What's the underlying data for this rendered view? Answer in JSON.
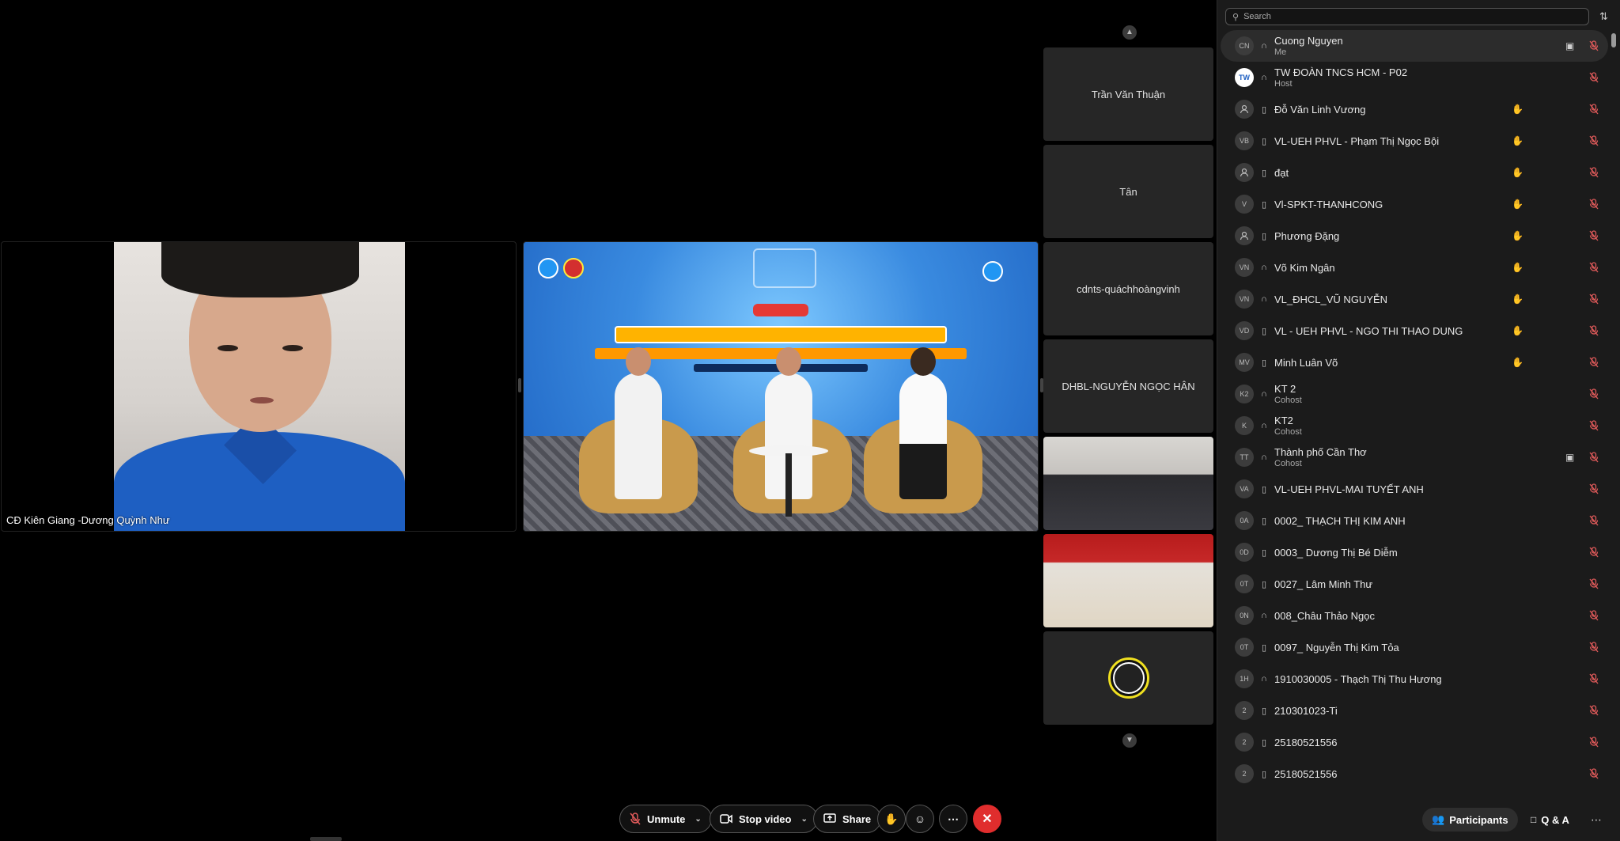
{
  "stage": {
    "speaker_name": "CĐ Kiên Giang -Dương Quỳnh Như"
  },
  "thumbnails": [
    {
      "name": "Trần Văn Thuận",
      "kind": "name"
    },
    {
      "name": "Tân",
      "kind": "name"
    },
    {
      "name": "cdnts-quáchhoàngvinh",
      "kind": "name"
    },
    {
      "name": "DHBL-NGUYỄN NGỌC HÂN",
      "kind": "name"
    },
    {
      "name": "",
      "kind": "video-a"
    },
    {
      "name": "",
      "kind": "video-b"
    },
    {
      "name": "",
      "kind": "avatar"
    }
  ],
  "panel": {
    "search_placeholder": "Search",
    "participants": [
      {
        "initials": "CN",
        "name": "Cuong Nguyen",
        "role": "Me",
        "device": "headset",
        "hand": false,
        "cam": true,
        "self": true
      },
      {
        "initials": "TW",
        "name": "TW ĐOÀN TNCS HCM - P02",
        "role": "Host",
        "device": "headset",
        "hand": false,
        "cam": false,
        "logo": true
      },
      {
        "initials": "",
        "name": "Đỗ Văn Linh Vương",
        "role": "",
        "device": "phone",
        "hand": true,
        "cam": false
      },
      {
        "initials": "VB",
        "name": "VL-UEH PHVL - Phạm Thị Ngọc Bội",
        "role": "",
        "device": "phone",
        "hand": true,
        "cam": false
      },
      {
        "initials": "",
        "name": "đạt",
        "role": "",
        "device": "phone",
        "hand": true,
        "cam": false
      },
      {
        "initials": "V",
        "name": "Vl-SPKT-THANHCONG",
        "role": "",
        "device": "phone",
        "hand": true,
        "cam": false
      },
      {
        "initials": "",
        "name": "Phương Đặng",
        "role": "",
        "device": "phone",
        "hand": true,
        "cam": false
      },
      {
        "initials": "VN",
        "name": "Võ Kim Ngân",
        "role": "",
        "device": "headset",
        "hand": true,
        "cam": false
      },
      {
        "initials": "VN",
        "name": "VL_ĐHCL_VŨ NGUYỄN",
        "role": "",
        "device": "headset",
        "hand": true,
        "cam": false
      },
      {
        "initials": "VD",
        "name": "VL - UEH PHVL - NGO THI THAO DUNG",
        "role": "",
        "device": "phone",
        "hand": true,
        "cam": false
      },
      {
        "initials": "MV",
        "name": "Minh Luân Võ",
        "role": "",
        "device": "phone",
        "hand": true,
        "cam": false
      },
      {
        "initials": "K2",
        "name": "KT 2",
        "role": "Cohost",
        "device": "headset",
        "hand": false,
        "cam": false
      },
      {
        "initials": "K",
        "name": "KT2",
        "role": "Cohost",
        "device": "headset",
        "hand": false,
        "cam": false
      },
      {
        "initials": "TT",
        "name": "Thành phố Cần Thơ",
        "role": "Cohost",
        "device": "headset",
        "hand": false,
        "cam": true
      },
      {
        "initials": "VA",
        "name": " VL-UEH PHVL-MAI TUYẾT ANH",
        "role": "",
        "device": "phone",
        "hand": false,
        "cam": false
      },
      {
        "initials": "0A",
        "name": "0002_ THẠCH THỊ KIM ANH",
        "role": "",
        "device": "phone",
        "hand": false,
        "cam": false
      },
      {
        "initials": "0D",
        "name": "0003_ Dương Thị Bé Diễm",
        "role": "",
        "device": "phone",
        "hand": false,
        "cam": false
      },
      {
        "initials": "0T",
        "name": "0027_ Lâm Minh Thư",
        "role": "",
        "device": "phone",
        "hand": false,
        "cam": false
      },
      {
        "initials": "0N",
        "name": "008_Châu Thảo Ngọc",
        "role": "",
        "device": "headset",
        "hand": false,
        "cam": false
      },
      {
        "initials": "0T",
        "name": "0097_ Nguyễn Thị Kim Tỏa",
        "role": "",
        "device": "phone",
        "hand": false,
        "cam": false
      },
      {
        "initials": "1H",
        "name": "1910030005 - Thạch Thị Thu Hương",
        "role": "",
        "device": "headset",
        "hand": false,
        "cam": false
      },
      {
        "initials": "2",
        "name": "210301023-Ti",
        "role": "",
        "device": "phone",
        "hand": false,
        "cam": false
      },
      {
        "initials": "2",
        "name": "25180521556",
        "role": "",
        "device": "phone",
        "hand": false,
        "cam": false
      },
      {
        "initials": "2",
        "name": "25180521556",
        "role": "",
        "device": "phone",
        "hand": false,
        "cam": false
      }
    ],
    "tabs": {
      "participants_label": "Participants",
      "qa_label": "Q & A"
    }
  },
  "toolbar": {
    "unmute_label": "Unmute",
    "stop_video_label": "Stop video",
    "share_label": "Share"
  },
  "colors": {
    "end_button": "#e02d2d",
    "muted_mic": "#e05a5a",
    "panel_bg": "#1b1b1b"
  }
}
